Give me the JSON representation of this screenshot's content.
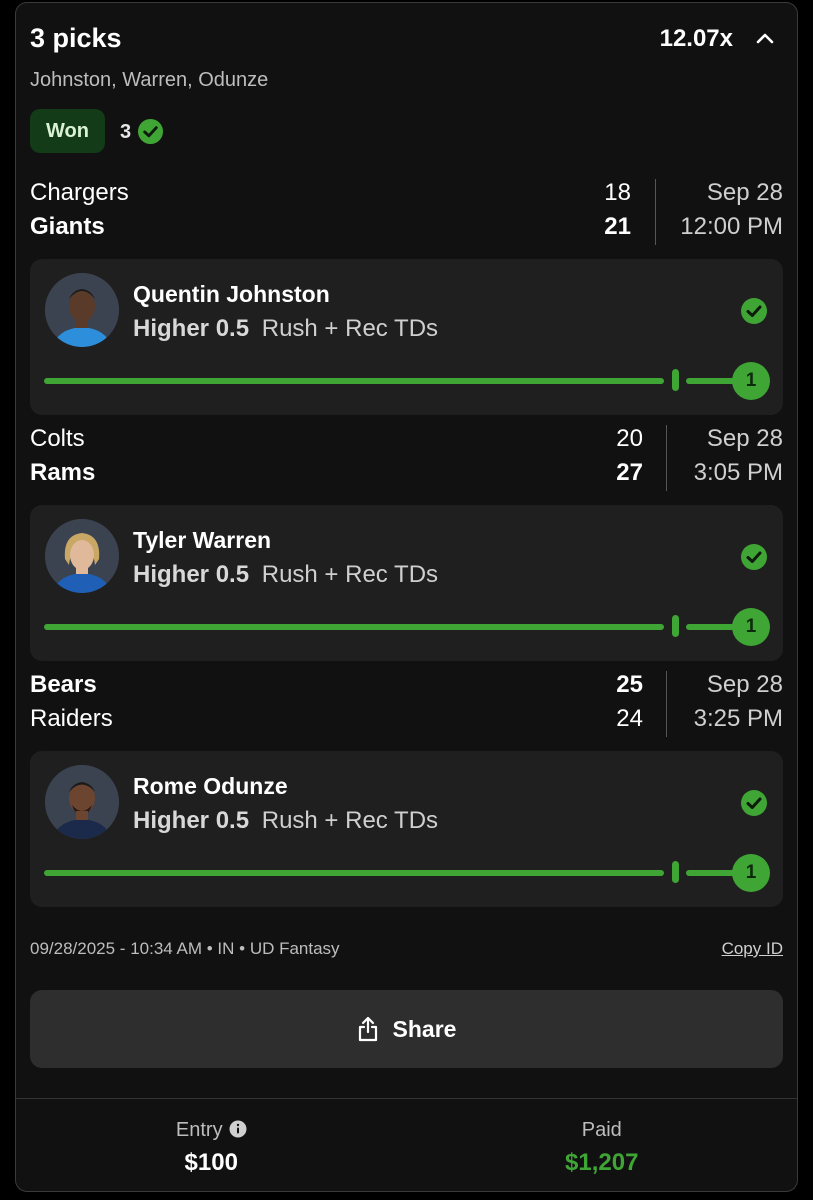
{
  "header": {
    "title": "3 picks",
    "multiplier": "12.07x",
    "names": "Johnston, Warren, Odunze"
  },
  "status": {
    "badge": "Won",
    "count": "3"
  },
  "games": [
    {
      "team1": "Chargers",
      "score1": "18",
      "team2": "Giants",
      "score2": "21",
      "winner": 2,
      "date": "Sep 28",
      "time": "12:00 PM",
      "pick": {
        "player": "Quentin Johnston",
        "direction": "Higher",
        "line": "0.5",
        "stat": "Rush + Rec TDs",
        "result": "1",
        "progress": 1.0
      }
    },
    {
      "team1": "Colts",
      "score1": "20",
      "team2": "Rams",
      "score2": "27",
      "winner": 2,
      "date": "Sep 28",
      "time": "3:05 PM",
      "pick": {
        "player": "Tyler Warren",
        "direction": "Higher",
        "line": "0.5",
        "stat": "Rush + Rec TDs",
        "result": "1",
        "progress": 1.0
      }
    },
    {
      "team1": "Bears",
      "score1": "25",
      "team2": "Raiders",
      "score2": "24",
      "winner": 1,
      "date": "Sep 28",
      "time": "3:25 PM",
      "pick": {
        "player": "Rome Odunze",
        "direction": "Higher",
        "line": "0.5",
        "stat": "Rush + Rec TDs",
        "result": "1",
        "progress": 1.0
      }
    }
  ],
  "meta": {
    "info": "09/28/2025 - 10:34 AM • IN • UD Fantasy",
    "copy_id": "Copy ID"
  },
  "share": {
    "label": "Share"
  },
  "footer": {
    "entry_label": "Entry",
    "entry_value": "$100",
    "paid_label": "Paid",
    "paid_value": "$1,207"
  },
  "colors": {
    "accent_green": "#3fa535",
    "won_badge_bg": "#143b17",
    "card_bg": "#111111",
    "pick_bg": "#1f1f1f"
  }
}
